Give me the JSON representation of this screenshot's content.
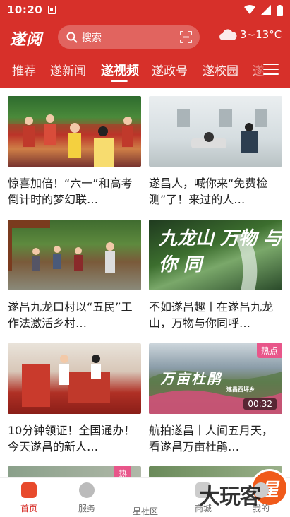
{
  "status_bar": {
    "time": "10:20"
  },
  "header": {
    "logo": "遂阅",
    "search": {
      "placeholder": "搜索"
    },
    "weather": {
      "temp": "3~13°C"
    }
  },
  "tabs": [
    {
      "label": "推荐"
    },
    {
      "label": "遂新闻"
    },
    {
      "label": "遂视频"
    },
    {
      "label": "遂政号"
    },
    {
      "label": "遂校园"
    },
    {
      "label": "遂"
    }
  ],
  "videos": [
    {
      "title": "惊喜加倍！“六一”和高考倒计时的梦幻联…"
    },
    {
      "title": "遂昌人，喊你来“免费检测”了！来过的人…"
    },
    {
      "title": "遂昌九龙口村以“五民”工作法激活乡村…"
    },
    {
      "title": "不如遂昌趣丨在遂昌九龙山，万物与你同呼…",
      "thumb_text": "九龙山 万物 与你 同"
    },
    {
      "title": "10分钟领证！全国通办！今天遂昌的新人…"
    },
    {
      "title": "航拍遂昌丨人间五月天，看遂昌万亩杜鹃…",
      "badge": "热点",
      "duration": "00:32",
      "thumb_text": "万亩杜鹃",
      "thumb_subtext": "遂昌西坪乡"
    }
  ],
  "partial_row_badge": "热",
  "bottom_nav": [
    {
      "label": "首页"
    },
    {
      "label": "服务"
    },
    {
      "label": "星社区",
      "center_glyph": "星"
    },
    {
      "label": "商城"
    },
    {
      "label": "我的"
    }
  ],
  "watermark": "大玩客",
  "colors": {
    "brand_red": "#d7302a",
    "star_orange": "#f05a1a",
    "hot_pink": "#e8568a"
  }
}
